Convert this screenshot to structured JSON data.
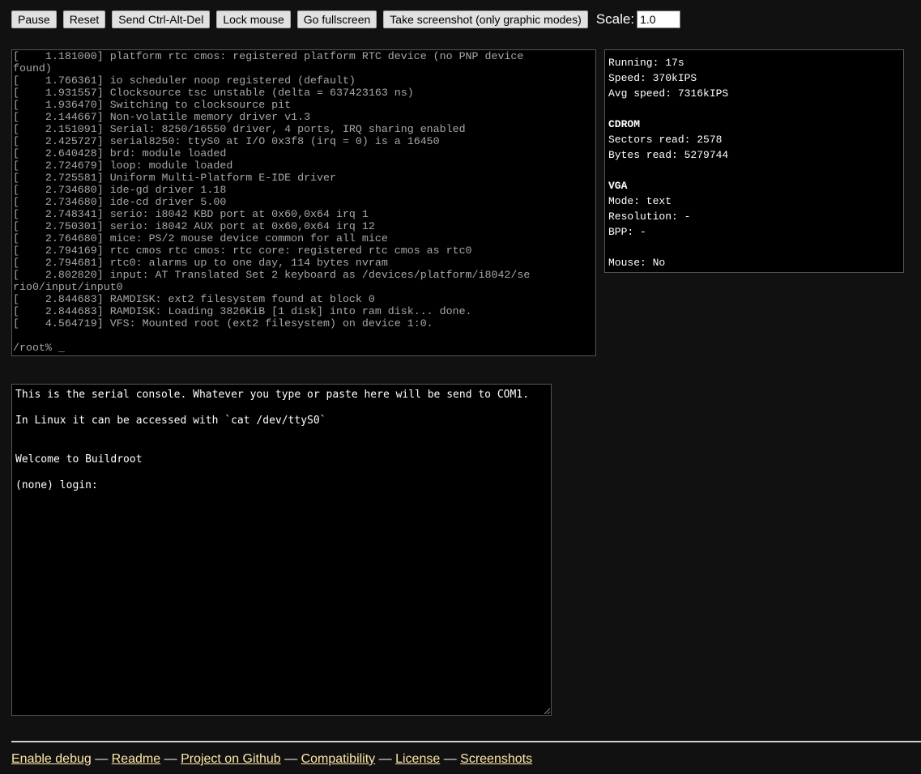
{
  "toolbar": {
    "pause": "Pause",
    "reset": "Reset",
    "ctrl_alt_del": "Send Ctrl-Alt-Del",
    "lock_mouse": "Lock mouse",
    "fullscreen": "Go fullscreen",
    "screenshot": "Take screenshot (only graphic modes)",
    "scale_label": "Scale:",
    "scale_value": "1.0"
  },
  "screen": {
    "lines": [
      "[    1.181000] platform rtc cmos: registered platform RTC device (no PNP device",
      "found)",
      "[    1.766361] io scheduler noop registered (default)",
      "[    1.931557] Clocksource tsc unstable (delta = 637423163 ns)",
      "[    1.936470] Switching to clocksource pit",
      "[    2.144667] Non-volatile memory driver v1.3",
      "[    2.151091] Serial: 8250/16550 driver, 4 ports, IRQ sharing enabled",
      "[    2.425727] serial8250: ttyS0 at I/O 0x3f8 (irq = 0) is a 16450",
      "[    2.640428] brd: module loaded",
      "[    2.724679] loop: module loaded",
      "[    2.725581] Uniform Multi-Platform E-IDE driver",
      "[    2.734680] ide-gd driver 1.18",
      "[    2.734680] ide-cd driver 5.00",
      "[    2.748341] serio: i8042 KBD port at 0x60,0x64 irq 1",
      "[    2.750301] serio: i8042 AUX port at 0x60,0x64 irq 12",
      "[    2.764680] mice: PS/2 mouse device common for all mice",
      "[    2.794169] rtc cmos rtc cmos: rtc core: registered rtc cmos as rtc0",
      "[    2.794681] rtc0: alarms up to one day, 114 bytes nvram",
      "[    2.802820] input: AT Translated Set 2 keyboard as /devices/platform/i8042/se",
      "rio0/input/input0",
      "[    2.844683] RAMDISK: ext2 filesystem found at block 0",
      "[    2.844683] RAMDISK: Loading 3826KiB [1 disk] into ram disk... done.",
      "[    4.564719] VFS: Mounted root (ext2 filesystem) on device 1:0.",
      "",
      "/root% _"
    ]
  },
  "stats": {
    "running": "Running: 17s",
    "speed": "Speed: 370kIPS",
    "avg_speed": "Avg speed: 7316kIPS",
    "cdrom_heading": "CDROM",
    "sectors_read": "Sectors read: 2578",
    "bytes_read": "Bytes read: 5279744",
    "vga_heading": "VGA",
    "mode": "Mode: text",
    "resolution": "Resolution: -",
    "bpp": "BPP: -",
    "mouse": "Mouse: No"
  },
  "serial": {
    "text": "This is the serial console. Whatever you type or paste here will be send to COM1.\n\nIn Linux it can be accessed with `cat /dev/ttyS0`\n\n\nWelcome to Buildroot\n\n(none) login: "
  },
  "footer": {
    "enable_debug": "Enable debug",
    "readme": "Readme",
    "github": "Project on Github",
    "compatibility": "Compatibility",
    "license": "License",
    "screenshots": "Screenshots",
    "separator": "—"
  }
}
